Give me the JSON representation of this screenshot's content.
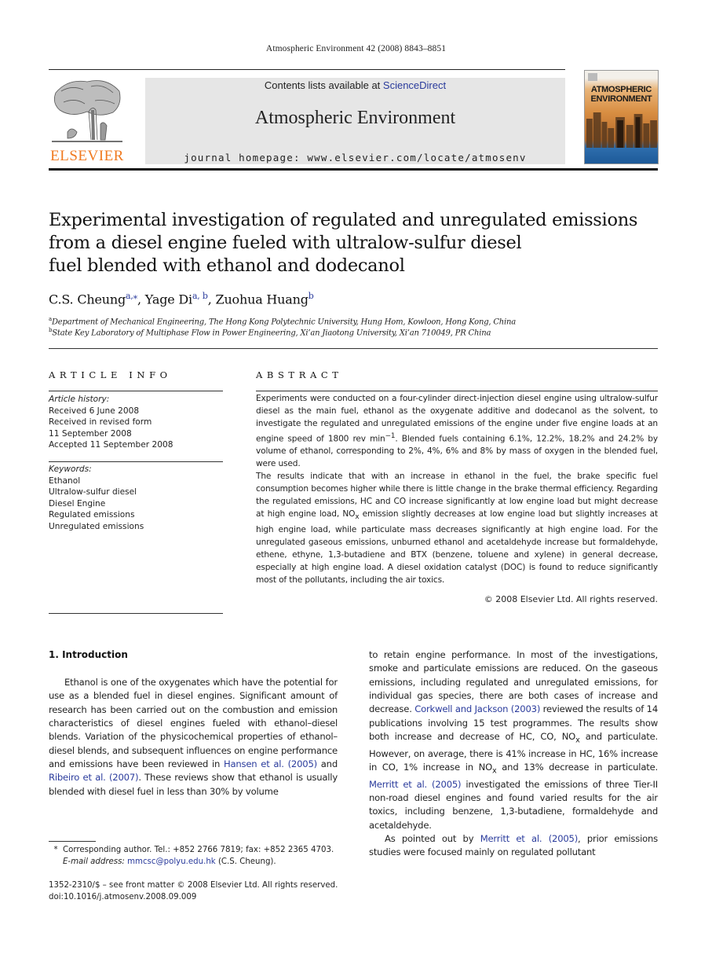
{
  "running_head": "Atmospheric Environment 42 (2008) 8843–8851",
  "header": {
    "publisher_logo_text": "ELSEVIER",
    "contents_prefix": "Contents lists available at ",
    "contents_link": "ScienceDirect",
    "journal_title": "Atmospheric Environment",
    "homepage": "journal homepage: www.elsevier.com/locate/atmosenv",
    "cover_title_line1": "ATMOSPHERIC",
    "cover_title_line2": "ENVIRONMENT",
    "colors": {
      "elsevier_orange": "#f07a20",
      "link_blue": "#2a3b9c",
      "banner_gray": "#e6e6e6"
    }
  },
  "article": {
    "title_lines": [
      "Experimental investigation of regulated and unregulated emissions",
      "from a diesel engine fueled with ultralow-sulfur diesel",
      "fuel blended with ethanol and dodecanol"
    ],
    "authors": [
      {
        "name": "C.S. Cheung",
        "affil": "a,⁎"
      },
      {
        "name": "Yage Di",
        "affil": "a, b"
      },
      {
        "name": "Zuohua Huang",
        "affil": "b"
      }
    ],
    "affiliations": [
      {
        "key": "a",
        "text": "Department of Mechanical Engineering, The Hong Kong Polytechnic University, Hung Hom, Kowloon, Hong Kong, China"
      },
      {
        "key": "b",
        "text": "State Key Laboratory of Multiphase Flow in Power Engineering, Xi’an Jiaotong University, Xi’an 710049, PR China"
      }
    ]
  },
  "article_info": {
    "heading": "ARTICLE INFO",
    "history_label": "Article history:",
    "history": [
      "Received 6 June 2008",
      "Received in revised form",
      "11 September 2008",
      "Accepted 11 September 2008"
    ],
    "keywords_label": "Keywords:",
    "keywords": [
      "Ethanol",
      "Ultralow-sulfur diesel",
      "Diesel Engine",
      "Regulated emissions",
      "Unregulated emissions"
    ]
  },
  "abstract": {
    "heading": "ABSTRACT",
    "p1_before_sup": "Experiments were conducted on a four-cylinder direct-injection diesel engine using ultralow-sulfur diesel as the main fuel, ethanol as the oxygenate additive and dodecanol as the solvent, to investigate the regulated and unregulated emissions of the engine under five engine loads at an engine speed of 1800 rev min",
    "p1_sup": "−1",
    "p1_after_sup": ". Blended fuels containing 6.1%, 12.2%, 18.2% and 24.2% by volume of ethanol, corresponding to 2%, 4%, 6% and 8% by mass of oxygen in the blended fuel, were used.",
    "p2_a": "The results indicate that with an increase in ethanol in the fuel, the brake specific fuel consumption becomes higher while there is little change in the brake thermal efficiency. Regarding the regulated emissions, HC and CO increase significantly at low engine load but might decrease at high engine load, NO",
    "p2_sub": "x",
    "p2_b": " emission slightly decreases at low engine load but slightly increases at high engine load, while particulate mass decreases significantly at high engine load. For the unregulated gaseous emissions, unburned ethanol and acetaldehyde increase but formaldehyde, ethene, ethyne, 1,3-butadiene and BTX (benzene, toluene and xylene) in general decrease, especially at high engine load. A diesel oxidation catalyst (DOC) is found to reduce significantly most of the pollutants, including the air toxics.",
    "copyright": "© 2008 Elsevier Ltd. All rights reserved."
  },
  "introduction": {
    "heading": "1.  Introduction",
    "left_p1_a": "Ethanol is one of the oxygenates which have the potential for use as a blended fuel in diesel engines. Significant amount of research has been carried out on the combustion and emission characteristics of diesel engines fueled with ethanol–diesel blends. Variation of the physicochemical properties of ethanol–diesel blends, and subsequent influences on engine performance and emissions have been reviewed in ",
    "left_link1": "Hansen et al. (2005)",
    "left_p1_b": " and ",
    "left_link2": "Ribeiro et al. (2007)",
    "left_p1_c": ". These reviews show that ethanol is usually blended with diesel fuel in less than 30% by volume",
    "right_p1_a": "to retain engine performance. In most of the investigations, smoke and particulate emissions are reduced. On the gaseous emissions, including regulated and unregulated emissions, for individual gas species, there are both cases of increase and decrease. ",
    "right_link1": "Corkwell and Jackson (2003)",
    "right_p1_b": " reviewed the results of 14 publications involving 15 test programmes. The results show both increase and decrease of HC, CO, NO",
    "right_sub1": "x",
    "right_p1_c": " and particulate. However, on average, there is 41% increase in HC, 16% increase in CO, 1% increase in NO",
    "right_sub2": "x",
    "right_p1_d": " and 13% decrease in particulate. ",
    "right_link2": "Merritt et al. (2005)",
    "right_p1_e": " investigated the emissions of three Tier-II non-road diesel engines and found varied results for the air toxics, including benzene, 1,3-butadiene, formaldehyde and acetaldehyde.",
    "right_p2_a": "As pointed out by ",
    "right_link3": "Merritt et al. (2005)",
    "right_p2_b": ", prior emissions studies were focused mainly on regulated pollutant"
  },
  "footnotes": {
    "star": "*",
    "corresponding": "Corresponding author. Tel.: +852 2766 7819; fax: +852 2365 4703.",
    "email_label": "E-mail address: ",
    "email": "mmcsc@polyu.edu.hk",
    "email_suffix": " (C.S. Cheung).",
    "front_matter": "1352-2310/$ – see front matter © 2008 Elsevier Ltd. All rights reserved.",
    "doi": "doi:10.1016/j.atmosenv.2008.09.009"
  }
}
